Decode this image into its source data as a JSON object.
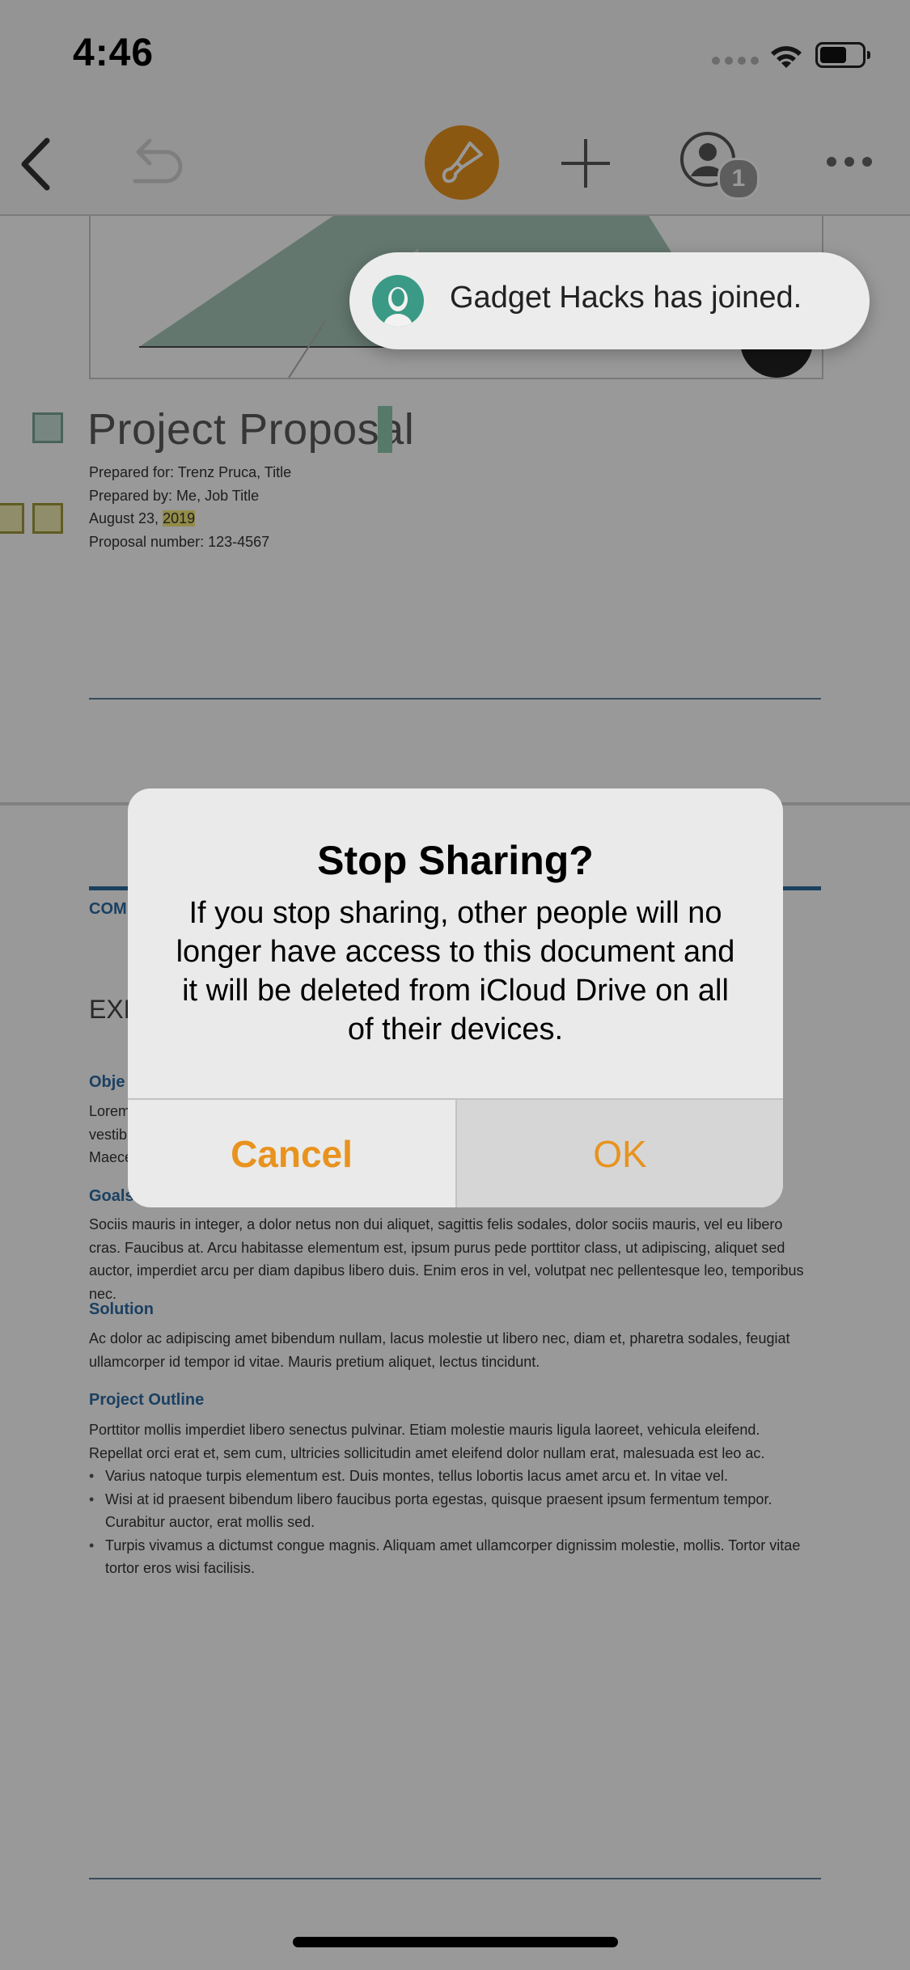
{
  "status_bar": {
    "time": "4:46"
  },
  "toolbar": {
    "collaborator_count": "1"
  },
  "notification": {
    "text": "Gadget Hacks has joined."
  },
  "document": {
    "title": "Project Proposal",
    "prepared_for": "Prepared for: Trenz Pruca, Title",
    "prepared_by": "Prepared by: Me, Job Title",
    "date_prefix": "August 23, ",
    "date_year": "2019",
    "proposal_number": "Proposal number: 123-4567",
    "section_cut": "COM",
    "exec_cut": "EXE",
    "objective_cut": "Obje",
    "objective_lines": [
      "Lorem",
      "vestibu",
      "Maece"
    ],
    "goals_heading": "Goals",
    "goals_text": "Sociis mauris in integer, a dolor netus non dui aliquet, sagittis felis sodales, dolor sociis mauris, vel eu libero cras. Faucibus at. Arcu habitasse elementum est, ipsum purus pede porttitor class, ut adipiscing, aliquet sed auctor, imperdiet arcu per diam dapibus libero duis. Enim eros in vel, volutpat nec pellentesque leo, temporibus nec.",
    "solution_heading": "Solution",
    "solution_text": "Ac dolor ac adipiscing amet bibendum nullam, lacus molestie ut libero nec, diam et, pharetra sodales, feugiat ullamcorper id tempor id vitae. Mauris pretium aliquet, lectus tincidunt.",
    "outline_heading": "Project Outline",
    "outline_text": "Porttitor mollis imperdiet libero senectus pulvinar. Etiam molestie mauris ligula laoreet, vehicula eleifend. Repellat orci erat et, sem cum, ultricies sollicitudin amet eleifend dolor nullam erat, malesuada est leo ac.",
    "outline_bullets": [
      "Varius natoque turpis elementum est. Duis montes, tellus lobortis lacus amet arcu et. In vitae vel.",
      "Wisi at id praesent bibendum libero faucibus porta egestas, quisque praesent ipsum fermentum tempor. Curabitur auctor, erat mollis sed.",
      "Turpis vivamus a dictumst congue magnis. Aliquam amet ullamcorper dignissim molestie, mollis. Tortor vitae tortor eros wisi facilisis."
    ]
  },
  "alert": {
    "title": "Stop Sharing?",
    "message": "If you stop sharing, other people will no longer have access to this document and it will be deleted from iCloud Drive on all of their devices.",
    "cancel_label": "Cancel",
    "ok_label": "OK"
  },
  "colors": {
    "accent": "#e8931e",
    "heading_blue": "#2e6ba3",
    "avatar_green": "#3a9a86"
  },
  "icons": [
    "back-icon",
    "undo-icon",
    "paintbrush-icon",
    "add-icon",
    "collaborate-icon",
    "more-icon",
    "wifi-icon",
    "battery-icon",
    "avatar-icon"
  ]
}
